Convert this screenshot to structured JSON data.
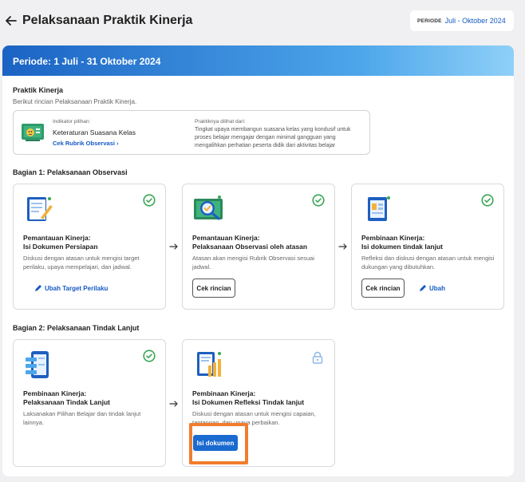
{
  "header": {
    "title": "Pelaksanaan Praktik Kinerja",
    "period_label": "PERIODE",
    "period_value": "Juli - Oktober 2024"
  },
  "banner": {
    "text": "Periode: 1 Juli - 31 Oktober 2024"
  },
  "praktik": {
    "title": "Praktik Kinerja",
    "subtitle": "Berikut rincian Pelaksanaan Praktik Kinerja.",
    "indicator_label": "Indikator pilihan:",
    "indicator_name": "Keteraturan Suasana Kelas",
    "rubric_link": "Cek Rubrik Observasi",
    "seen_label": "Praktiknya dilihat dari:",
    "seen_text": "Tingkat upaya membangun suasana kelas yang kondusif untuk proses belajar mengajar dengan minimal gangguan yang mengalihkan perhatian peserta didik dari aktivitas belajar"
  },
  "bagian1": {
    "title": "Bagian 1: Pelaksanaan Observasi",
    "cards": [
      {
        "title_line1": "Pemantauan Kinerja:",
        "title_line2": "Isi Dokumen Persiapan",
        "desc": "Diskusi dengan atasan untuk mengisi target perilaku, upaya mempelajari, dan jadwal.",
        "action_label": "Ubah Target Perilaku"
      },
      {
        "title_line1": "Pemantauan Kinerja:",
        "title_line2": "Pelaksanaan Observasi oleh atasan",
        "desc": "Atasan akan mengisi Rubrik Observasi sesuai jadwal.",
        "action_label": "Cek rincian"
      },
      {
        "title_line1": "Pembinaan Kinerja:",
        "title_line2": "Isi dokumen tindak lanjut",
        "desc": "Refleksi dan diskusi dengan atasan untuk mengisi dukungan yang dibutuhkan.",
        "action_label": "Cek rincian",
        "action2_label": "Ubah"
      }
    ]
  },
  "bagian2": {
    "title": "Bagian 2: Pelaksanaan Tindak Lanjut",
    "cards": [
      {
        "title_line1": "Pembinaan Kinerja:",
        "title_line2": "Pelaksanaan Tindak Lanjut",
        "desc": "Laksanakan Pilihan Belajar dan tindak lanjut lainnya."
      },
      {
        "title_line1": "Pembinaan Kinerja:",
        "title_line2": "Isi Dokumen Refleksi Tindak lanjut",
        "desc": "Diskusi dengan atasan untuk mengisi capaian, tantangan, dan upaya perbaikan.",
        "action_label": "Isi dokumen"
      }
    ]
  },
  "colors": {
    "primary": "#1a6ad0",
    "check": "#3aa655",
    "highlight": "#f07d2e",
    "lock": "#8fb8e8"
  }
}
